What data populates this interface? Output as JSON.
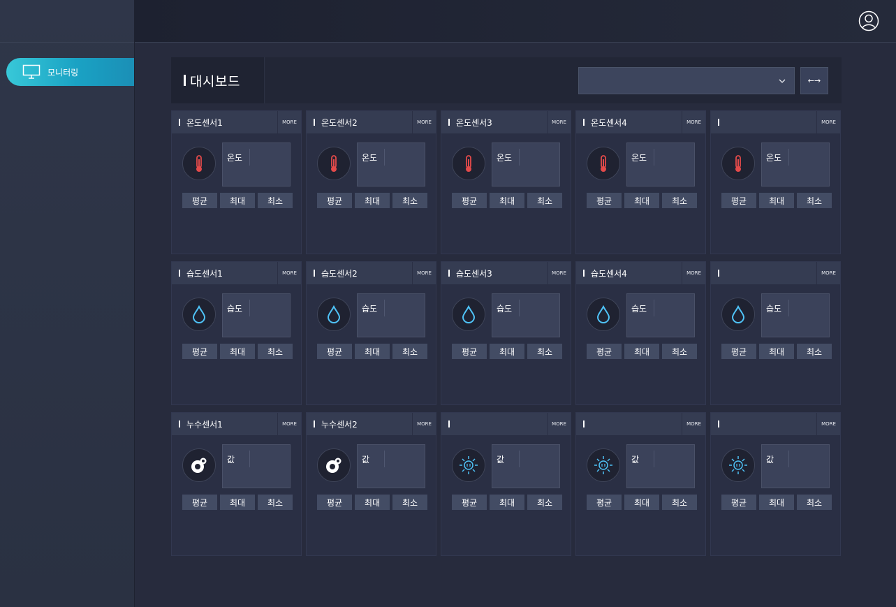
{
  "sidebar": {
    "items": [
      {
        "label": "모니터링",
        "icon": "monitor-icon"
      }
    ]
  },
  "topbar": {
    "user_icon": "user-icon"
  },
  "dashboard": {
    "title": "대시보드",
    "select_value": "",
    "swap_label": "←→"
  },
  "stat_labels": {
    "avg": "평균",
    "max": "최대",
    "min": "최소"
  },
  "more_label": "MORE",
  "rows": [
    {
      "value_label": "온도",
      "icon": "thermometer-icon",
      "cards": [
        {
          "title": "온도센서1"
        },
        {
          "title": "온도센서2"
        },
        {
          "title": "온도센서3"
        },
        {
          "title": "온도센서4"
        },
        {
          "title": ""
        }
      ]
    },
    {
      "value_label": "습도",
      "icon": "water-drop-icon",
      "cards": [
        {
          "title": "습도센서1"
        },
        {
          "title": "습도센서2"
        },
        {
          "title": "습도센서3"
        },
        {
          "title": "습도센서4"
        },
        {
          "title": ""
        }
      ]
    },
    {
      "value_label": "값",
      "cards": [
        {
          "title": "누수센서1",
          "icon": "leak-sensor-icon"
        },
        {
          "title": "누수센서2",
          "icon": "leak-sensor-icon"
        },
        {
          "title": "",
          "icon": "light-sensor-icon"
        },
        {
          "title": "",
          "icon": "light-sensor-icon"
        },
        {
          "title": "",
          "icon": "light-sensor-icon"
        }
      ]
    }
  ],
  "colors": {
    "accent": "#1aa2c4",
    "thermometer": "#e34a4a",
    "drop": "#4fc3f7"
  }
}
